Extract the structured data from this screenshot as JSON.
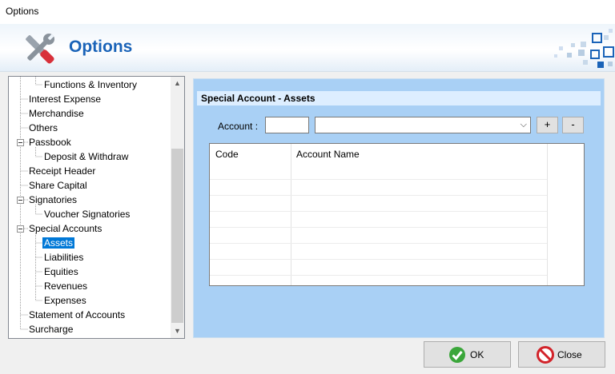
{
  "window": {
    "title": "Options"
  },
  "header": {
    "title": "Options",
    "logo_icon": "tools-icon"
  },
  "tree": {
    "items": [
      {
        "label": "Functions & Inventory"
      },
      {
        "label": "Interest Expense"
      },
      {
        "label": "Merchandise"
      },
      {
        "label": "Others"
      },
      {
        "label": "Passbook"
      },
      {
        "label": "Deposit & Withdraw"
      },
      {
        "label": "Receipt Header"
      },
      {
        "label": "Share Capital"
      },
      {
        "label": "Signatories"
      },
      {
        "label": "Voucher Signatories"
      },
      {
        "label": "Special Accounts"
      },
      {
        "label": "Assets"
      },
      {
        "label": "Liabilities"
      },
      {
        "label": "Equities"
      },
      {
        "label": "Revenues"
      },
      {
        "label": "Expenses"
      },
      {
        "label": "Statement of Accounts"
      },
      {
        "label": "Surcharge"
      }
    ],
    "selected": "Assets"
  },
  "panel": {
    "title": "Special Account - Assets",
    "account_label": "Account :",
    "account_code_value": "",
    "account_select_value": "",
    "add_label": "+",
    "remove_label": "-",
    "grid": {
      "columns": [
        "Code",
        "Account Name"
      ],
      "rows": []
    }
  },
  "footer": {
    "ok_label": "OK",
    "close_label": "Close"
  },
  "colors": {
    "accent": "#1a63b8",
    "panel_bg": "#a9d0f5",
    "selection": "#0078d7"
  }
}
